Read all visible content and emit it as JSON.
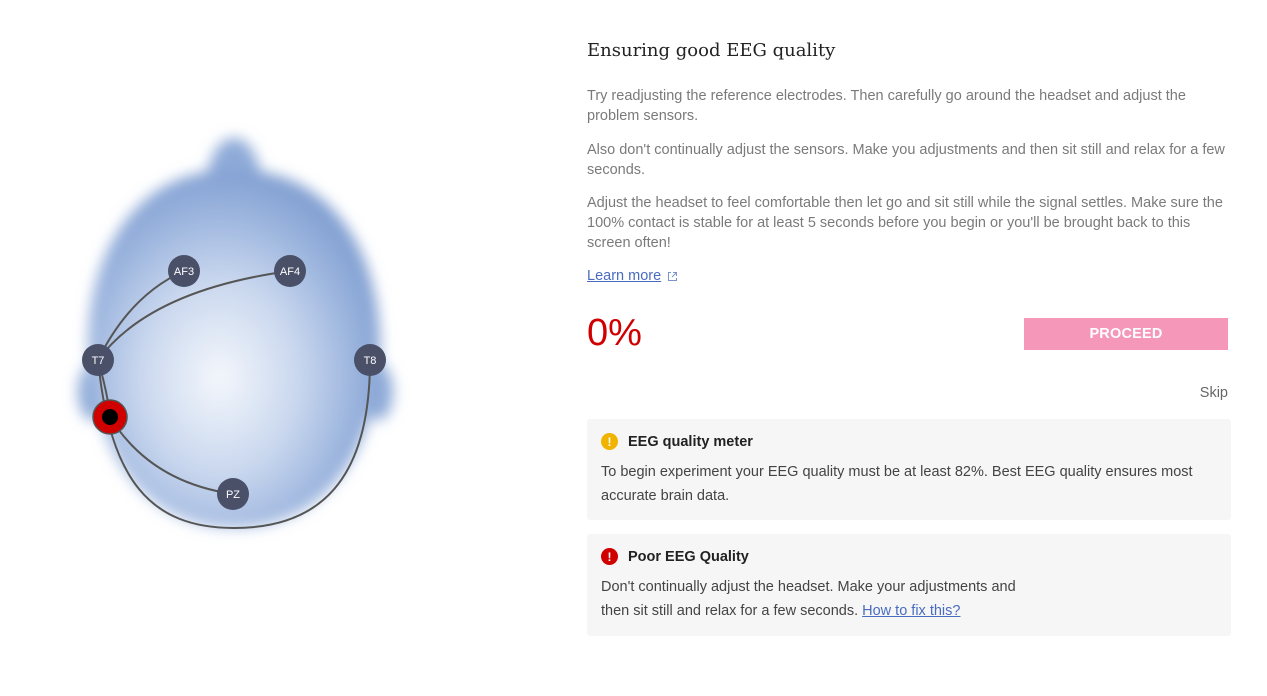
{
  "header": {
    "title": "Ensuring good EEG quality"
  },
  "instructions": [
    "Try readjusting the reference electrodes. Then carefully go around the headset and adjust the problem sensors.",
    "Also don't continually adjust the sensors. Make you adjustments and then sit still and relax for a few seconds.",
    "Adjust the headset to feel comfortable then let go and sit still while the signal settles. Make sure the 100% contact is stable for at least 5 seconds before you begin or you'll be brought back to this screen often!"
  ],
  "learn_more": {
    "label": "Learn more",
    "icon": "external-link-icon"
  },
  "quality": {
    "percent_label": "0%",
    "color": "#d10000"
  },
  "proceed_button": {
    "label": "PROCEED",
    "color": "#f597b8"
  },
  "skip_label": "Skip",
  "meter_card": {
    "title": "EEG quality meter",
    "icon": "warning-icon",
    "icon_color": "#f0b400",
    "text": "To begin experiment your EEG quality must be at least 82%. Best EEG quality ensures most accurate brain data."
  },
  "poor_card": {
    "title": "Poor EEG Quality",
    "icon": "error-icon",
    "icon_color": "#d10000",
    "text_line1": "Don't continually adjust the headset. Make your adjustments and",
    "text_line2": "then sit still and relax for a few seconds.",
    "link": "How to fix this?"
  },
  "electrodes": [
    {
      "id": "af3",
      "label": "AF3",
      "status": "unknown"
    },
    {
      "id": "af4",
      "label": "AF4",
      "status": "unknown"
    },
    {
      "id": "t7",
      "label": "T7",
      "status": "unknown"
    },
    {
      "id": "t8",
      "label": "T8",
      "status": "unknown"
    },
    {
      "id": "pz",
      "label": "PZ",
      "status": "unknown"
    },
    {
      "id": "ref",
      "label": "",
      "status": "bad"
    }
  ]
}
